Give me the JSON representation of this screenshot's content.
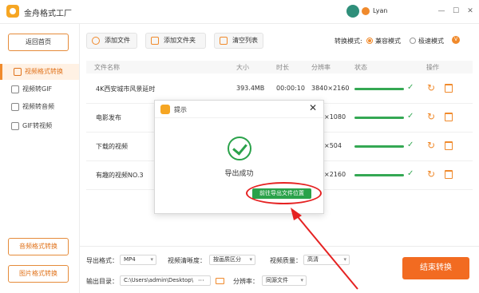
{
  "titlebar": {
    "app_title": "金舟格式工厂",
    "username": "Lyan",
    "minimize": "—",
    "maximize": "☐",
    "close": "✕"
  },
  "sidebar": {
    "back_label": "返回首页",
    "items": [
      {
        "label": "视频格式转换",
        "active": true
      },
      {
        "label": "视频转GIF",
        "active": false
      },
      {
        "label": "视频转音频",
        "active": false
      },
      {
        "label": "GIF转视频",
        "active": false
      }
    ],
    "audio_convert_label": "音频格式转换",
    "image_convert_label": "图片格式转换"
  },
  "toolbar": {
    "add_file_label": "添加文件",
    "add_folder_label": "添加文件夹",
    "clear_list_label": "清空列表",
    "mode_label": "转换模式:",
    "mode_compat_label": "兼容模式",
    "mode_fast_label": "极速模式",
    "vip_badge": "V"
  },
  "table": {
    "headers": [
      "文件名称",
      "大小",
      "时长",
      "分辨率",
      "状态",
      "操作"
    ],
    "rows": [
      {
        "name": "4K西安城市风景延时",
        "size": "393.4MB",
        "duration": "00:00:10",
        "resolution": "3840×2160"
      },
      {
        "name": "电影发布",
        "size": "",
        "duration": "",
        "resolution": "×1080"
      },
      {
        "name": "下载的视频",
        "size": "",
        "duration": "",
        "resolution": "×504"
      },
      {
        "name": "有趣的视频NO.3",
        "size": "",
        "duration": "",
        "resolution": "×2160"
      }
    ]
  },
  "bottom": {
    "format_label": "导出格式：",
    "format_value": "MP4",
    "clarity_label": "视频清晰度：",
    "clarity_value": "按画质区分",
    "quality_label": "视频质量：",
    "quality_value": "高清",
    "dir_label": "输出目录：",
    "dir_value": "C:\\Users\\admin\\Desktop\\",
    "dir_more": "···",
    "res_label": "分辨率：",
    "res_value": "同源文件",
    "finish_label": "结束转换"
  },
  "dialog": {
    "title": "提示",
    "close": "✕",
    "message": "导出成功",
    "open_button": "前往导出文件位置"
  },
  "colors": {
    "accent": "#f08a2c",
    "success": "#2aa24a",
    "highlight": "#e52222"
  }
}
